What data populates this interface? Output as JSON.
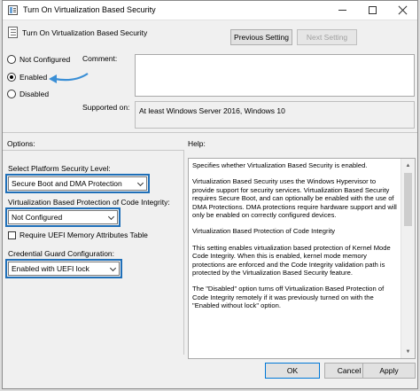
{
  "window": {
    "title": "Turn On Virtualization Based Security"
  },
  "header": {
    "title": "Turn On Virtualization Based Security",
    "previous_label": "Previous Setting",
    "next_label": "Next Setting"
  },
  "state": {
    "options": [
      "Not Configured",
      "Enabled",
      "Disabled"
    ],
    "selected": "Enabled"
  },
  "comment": {
    "label": "Comment:",
    "value": ""
  },
  "supported": {
    "label": "Supported on:",
    "value": "At least Windows Server 2016, Windows 10"
  },
  "options_section": {
    "label": "Options:",
    "platform_label": "Select Platform Security Level:",
    "platform_value": "Secure Boot and DMA Protection",
    "code_integrity_label": "Virtualization Based Protection of Code Integrity:",
    "code_integrity_value": "Not Configured",
    "uefi_label": "Require UEFI Memory Attributes Table",
    "uefi_checked": false,
    "credential_label": "Credential Guard Configuration:",
    "credential_value": "Enabled with UEFI lock"
  },
  "help_section": {
    "label": "Help:",
    "paragraphs": [
      "Specifies whether Virtualization Based Security is enabled.",
      "Virtualization Based Security uses the Windows Hypervisor to provide support for security services. Virtualization Based Security requires Secure Boot, and can optionally be enabled with the use of DMA Protections. DMA protections require hardware support and will only be enabled on correctly configured devices.",
      "Virtualization Based Protection of Code Integrity",
      "This setting enables virtualization based protection of Kernel Mode Code Integrity. When this is enabled, kernel mode memory protections are enforced and the Code Integrity validation path is protected by the Virtualization Based Security feature.",
      "The \"Disabled\" option turns off Virtualization Based Protection of Code Integrity remotely if it was previously turned on with the \"Enabled without lock\" option."
    ]
  },
  "footer": {
    "ok_label": "OK",
    "cancel_label": "Cancel",
    "apply_label": "Apply"
  },
  "colors": {
    "highlight": "#1f6fb8",
    "arrow": "#3a8fd6"
  },
  "icons": [
    "app-icon",
    "policy-icon",
    "minimize-icon",
    "maximize-icon",
    "close-icon",
    "arrow-icon",
    "chevron-down-icon"
  ]
}
